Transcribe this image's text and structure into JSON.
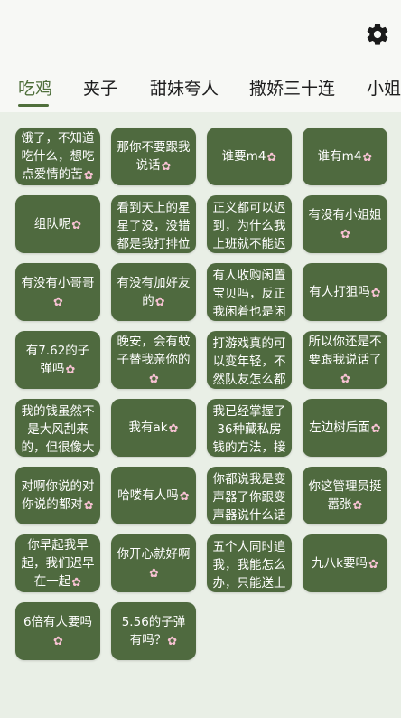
{
  "tabs": [
    {
      "label": "吃鸡",
      "active": true
    },
    {
      "label": "夹子",
      "active": false
    },
    {
      "label": "甜妹夸人",
      "active": false
    },
    {
      "label": "撒娇三十连",
      "active": false
    },
    {
      "label": "小姐",
      "active": false
    }
  ],
  "icons": {
    "settings": "gear-icon",
    "card_badge": "flower-icon"
  },
  "colors": {
    "card": "#4f6a3f",
    "accent": "#4f6f3b",
    "flower": "#f7c2d3",
    "background": "#e9efe6"
  },
  "flower_glyph": "✿",
  "cards": [
    {
      "text": "饿了，不知道吃什么，想吃点爱情的苦",
      "flower": true
    },
    {
      "text": "那你不要跟我说话",
      "flower": true
    },
    {
      "text": "谁要m4",
      "flower": true
    },
    {
      "text": "谁有m4",
      "flower": true
    },
    {
      "text": "组队呢",
      "flower": true
    },
    {
      "text": "看到天上的星星了没，没错都是我打排位",
      "flower": false
    },
    {
      "text": "正义都可以迟到，为什么我上班就不能迟",
      "flower": false
    },
    {
      "text": "有没有小姐姐",
      "flower": true
    },
    {
      "text": "有没有小哥哥",
      "flower": true
    },
    {
      "text": "有没有加好友的",
      "flower": true
    },
    {
      "text": "有人收购闲置宝贝吗，反正我闲着也是闲",
      "flower": false
    },
    {
      "text": "有人打狙吗",
      "flower": true
    },
    {
      "text": "有7.62的子弹吗",
      "flower": true
    },
    {
      "text": "晚安，会有蚊子替我亲你的",
      "flower": true
    },
    {
      "text": "打游戏真的可以变年轻，不然队友怎么都",
      "flower": false
    },
    {
      "text": "所以你还是不要跟我说话了",
      "flower": true
    },
    {
      "text": "我的钱虽然不是大风刮来的，但很像大",
      "flower": false
    },
    {
      "text": "我有ak",
      "flower": true
    },
    {
      "text": "我已经掌握了36种藏私房钱的方法，接下",
      "flower": false
    },
    {
      "text": "左边树后面",
      "flower": true
    },
    {
      "text": "对啊你说的对你说的都对",
      "flower": true
    },
    {
      "text": "哈喽有人吗",
      "flower": true
    },
    {
      "text": "你都说我是变声器了你跟变声器说什么话",
      "flower": false
    },
    {
      "text": "你这管理员挺嚣张",
      "flower": true
    },
    {
      "text": "你早起我早起，我们迟早在一起",
      "flower": true
    },
    {
      "text": "你开心就好啊",
      "flower": true
    },
    {
      "text": "五个人同时追我，我能怎么办，只能送上",
      "flower": false
    },
    {
      "text": "九八k要吗",
      "flower": true
    },
    {
      "text": "6倍有人要吗",
      "flower": true
    },
    {
      "text": "5.56的子弹有吗？",
      "flower": true
    }
  ]
}
